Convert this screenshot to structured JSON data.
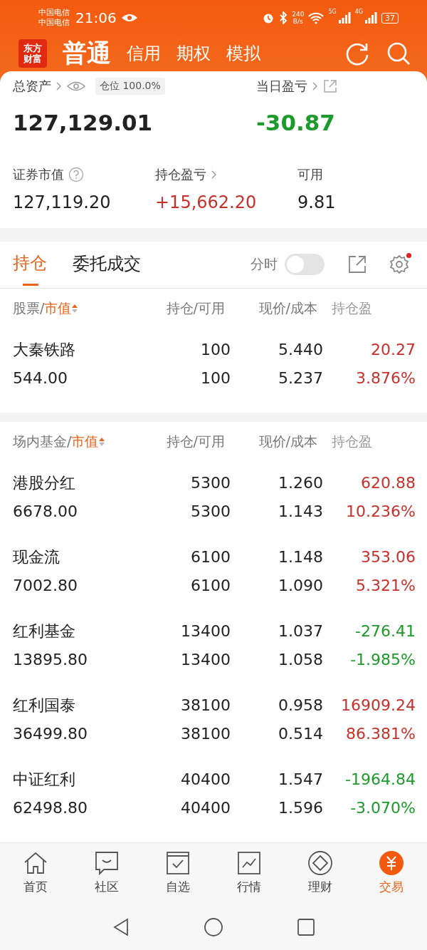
{
  "status_bar": {
    "carrier_1": "中国电信",
    "carrier_2": "中国电信",
    "time": "21:06",
    "speed_value": "240",
    "speed_unit": "B/s",
    "net_1": "5G",
    "net_2": "4G",
    "battery": "37"
  },
  "header": {
    "logo": [
      "东方",
      "财富"
    ],
    "tabs": [
      {
        "label": "普通",
        "selected": true
      },
      {
        "label": "信用",
        "selected": false
      },
      {
        "label": "期权",
        "selected": false
      },
      {
        "label": "模拟",
        "selected": false
      }
    ]
  },
  "summary": {
    "total_label": "总资产",
    "position_badge": "仓位 100.0%",
    "total_value": "127,129.01",
    "daily_label": "当日盈亏",
    "daily_value": "-30.87",
    "stats": [
      {
        "label": "证券市值",
        "value": "127,119.20",
        "kind": "help",
        "color": "#222222"
      },
      {
        "label": "持仓盈亏",
        "value": "+15,662.20",
        "kind": "link",
        "color": "#c8302b"
      },
      {
        "label": "可用",
        "value": "9.81",
        "kind": "plain",
        "color": "#222222"
      }
    ]
  },
  "position_tabs": [
    {
      "label": "持仓",
      "selected": true
    },
    {
      "label": "委托成交",
      "selected": false
    }
  ],
  "intraday_toggle": {
    "label": "分时",
    "on": false
  },
  "settings_dot": true,
  "sections": [
    {
      "header": {
        "name": "股票/",
        "sort": "市值",
        "columns": [
          "持仓/可用",
          "现价/成本",
          "持仓盈"
        ]
      },
      "rows": [
        {
          "name": "大秦铁路",
          "market_value": "544.00",
          "holding": "100",
          "available": "100",
          "price": "5.440",
          "cost": "5.237",
          "pnl": "20.27",
          "pnl_pct": "3.876%",
          "color": "#c8302b"
        }
      ]
    },
    {
      "header": {
        "name": "场内基金/",
        "sort": "市值",
        "columns": [
          "持仓/可用",
          "现价/成本",
          "持仓盈"
        ]
      },
      "rows": [
        {
          "name": "港股分红",
          "market_value": "6678.00",
          "holding": "5300",
          "available": "5300",
          "price": "1.260",
          "cost": "1.143",
          "pnl": "620.88",
          "pnl_pct": "10.236%",
          "color": "#c8302b"
        },
        {
          "name": "现金流",
          "market_value": "7002.80",
          "holding": "6100",
          "available": "6100",
          "price": "1.148",
          "cost": "1.090",
          "pnl": "353.06",
          "pnl_pct": "5.321%",
          "color": "#c8302b"
        },
        {
          "name": "红利基金",
          "market_value": "13895.80",
          "holding": "13400",
          "available": "13400",
          "price": "1.037",
          "cost": "1.058",
          "pnl": "-276.41",
          "pnl_pct": "-1.985%",
          "color": "#1d9a2c"
        },
        {
          "name": "红利国泰",
          "market_value": "36499.80",
          "holding": "38100",
          "available": "38100",
          "price": "0.958",
          "cost": "0.514",
          "pnl": "16909.24",
          "pnl_pct": "86.381%",
          "color": "#c8302b"
        },
        {
          "name": "中证红利",
          "market_value": "62498.80",
          "holding": "40400",
          "available": "40400",
          "price": "1.547",
          "cost": "1.596",
          "pnl": "-1964.84",
          "pnl_pct": "-3.070%",
          "color": "#1d9a2c"
        }
      ]
    }
  ],
  "bottom_nav": [
    {
      "label": "首页",
      "kind": "home",
      "selected": false
    },
    {
      "label": "社区",
      "kind": "chat",
      "selected": false
    },
    {
      "label": "自选",
      "kind": "check",
      "selected": false
    },
    {
      "label": "行情",
      "kind": "chart",
      "selected": false
    },
    {
      "label": "理财",
      "kind": "diamond",
      "selected": false
    },
    {
      "label": "交易",
      "kind": "yuan",
      "selected": true
    }
  ]
}
